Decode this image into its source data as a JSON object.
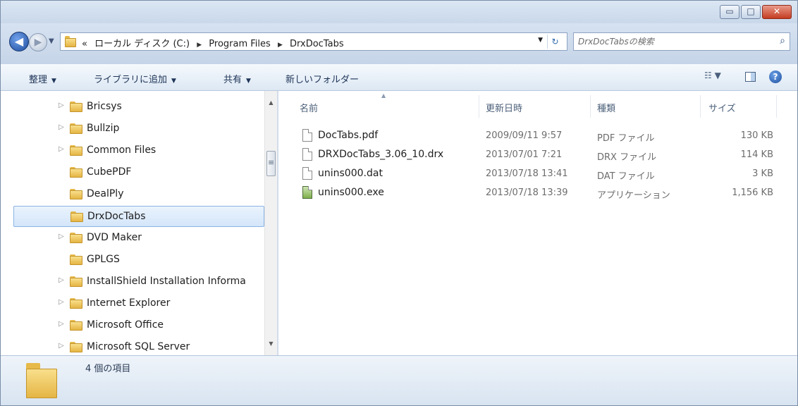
{
  "window": {
    "minimize_glyph": "▭",
    "maximize_glyph": "□",
    "close_glyph": "✕"
  },
  "address": {
    "overflow": "«",
    "crumbs": [
      "ローカル ディスク (C:)",
      "Program Files",
      "DrxDocTabs"
    ],
    "separator": "▶",
    "dropdown_glyph": "▼",
    "refresh_glyph": "↻"
  },
  "nav": {
    "back_glyph": "◀",
    "forward_glyph": "▶",
    "history_glyph": "▼"
  },
  "search": {
    "placeholder": "DrxDocTabsの検索",
    "icon_glyph": "⌕"
  },
  "toolbar": {
    "organize": "整理",
    "add_to_library": "ライブラリに追加",
    "share": "共有",
    "new_folder": "新しいフォルダー",
    "caret": "▼",
    "view_glyph": "☷ ▼",
    "help_glyph": "?"
  },
  "tree": {
    "expander_glyph": "▷",
    "items": [
      {
        "label": "Bricsys",
        "expandable": true,
        "selected": false
      },
      {
        "label": "Bullzip",
        "expandable": true,
        "selected": false
      },
      {
        "label": "Common Files",
        "expandable": true,
        "selected": false
      },
      {
        "label": "CubePDF",
        "expandable": false,
        "selected": false
      },
      {
        "label": "DealPly",
        "expandable": false,
        "selected": false
      },
      {
        "label": "DrxDocTabs",
        "expandable": false,
        "selected": true
      },
      {
        "label": "DVD Maker",
        "expandable": true,
        "selected": false
      },
      {
        "label": "GPLGS",
        "expandable": false,
        "selected": false
      },
      {
        "label": "InstallShield Installation Informa",
        "expandable": true,
        "selected": false
      },
      {
        "label": "Internet Explorer",
        "expandable": true,
        "selected": false
      },
      {
        "label": "Microsoft Office",
        "expandable": true,
        "selected": false
      },
      {
        "label": "Microsoft SQL Server",
        "expandable": true,
        "selected": false
      }
    ],
    "scroll_up": "▲",
    "scroll_down": "▼"
  },
  "columns": {
    "name": "名前",
    "modified": "更新日時",
    "type": "種類",
    "size": "サイズ",
    "sort_glyph": "▲"
  },
  "files": [
    {
      "name": "DocTabs.pdf",
      "modified": "2009/09/11 9:57",
      "type": "PDF ファイル",
      "size": "130 KB",
      "icon": "document-icon"
    },
    {
      "name": "DRXDocTabs_3.06_10.drx",
      "modified": "2013/07/01 7:21",
      "type": "DRX ファイル",
      "size": "114 KB",
      "icon": "document-icon"
    },
    {
      "name": "unins000.dat",
      "modified": "2013/07/18 13:41",
      "type": "DAT ファイル",
      "size": "3 KB",
      "icon": "document-icon"
    },
    {
      "name": "unins000.exe",
      "modified": "2013/07/18 13:39",
      "type": "アプリケーション",
      "size": "1,156 KB",
      "icon": "installer-icon"
    }
  ],
  "details": {
    "item_count": "4 個の項目"
  },
  "colors": {
    "selection_border": "#8bb4e3",
    "folder_yellow": "#e5b544",
    "close_red": "#c43c22"
  }
}
